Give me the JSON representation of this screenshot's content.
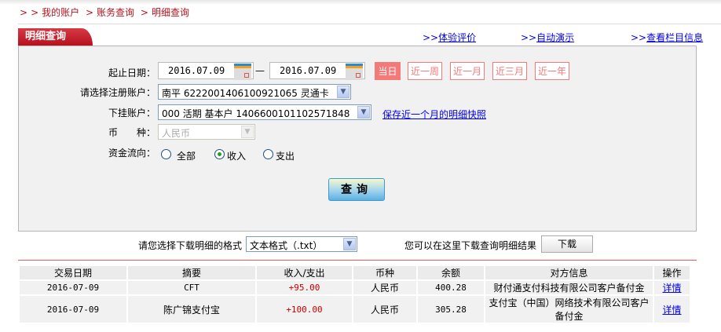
{
  "breadcrumb": {
    "prefix": ">",
    "items": [
      "我的账户",
      "账务查询",
      "明细查询"
    ]
  },
  "tab_title": "明细查询",
  "top_links": [
    {
      "prefix": ">>",
      "label": "体验评价"
    },
    {
      "prefix": ">>",
      "label": "自动演示"
    },
    {
      "prefix": ">>",
      "label": "查看栏目信息"
    }
  ],
  "form": {
    "date_label": "起止日期：",
    "start_date": "2016.07.09",
    "dash": "—",
    "end_date": "2016.07.09",
    "quick_ranges": [
      {
        "label": "当日",
        "active": true
      },
      {
        "label": "近一周"
      },
      {
        "label": "近一月"
      },
      {
        "label": "近三月"
      },
      {
        "label": "近一年"
      }
    ],
    "account_label": "请选择注册账户：",
    "account_value": "南平  6222001406100921065  灵通卡",
    "sub_account_label": "下挂账户：",
    "sub_account_value": "000  活期  基本户  1406600101102571848",
    "snapshot_link": "保存近一个月的明细快照",
    "currency_label": "币　　种：",
    "currency_value": "人民币",
    "flow_label": "资金流向：",
    "flow_options": [
      {
        "label": "全部",
        "checked": false
      },
      {
        "label": "收入",
        "checked": true
      },
      {
        "label": "支出",
        "checked": false
      }
    ],
    "query_button": "查询"
  },
  "download": {
    "format_label": "请您选择下载明细的格式",
    "format_value": "文本格式（.txt）",
    "hint": "您可以在这里下载查询明细结果",
    "button": "下载"
  },
  "table": {
    "headers": [
      "交易日期",
      "摘要",
      "收入/支出",
      "币种",
      "余额",
      "对方信息",
      "操作"
    ],
    "rows": [
      [
        "2016-07-09",
        "CFT",
        "+95.00",
        "人民币",
        "400.28",
        "财付通支付科技有限公司客户备付金",
        "详情"
      ],
      [
        "2016-07-09",
        "陈广锦支付宝",
        "+100.00",
        "人民币",
        "305.28",
        "支付宝（中国）网络技术有限公司客户备付金",
        "详情"
      ]
    ]
  },
  "colors": {
    "brand_red": "#b5121b",
    "quick_range": "#f47a7a",
    "link": "#0000ee",
    "amount": "#cc0000"
  }
}
